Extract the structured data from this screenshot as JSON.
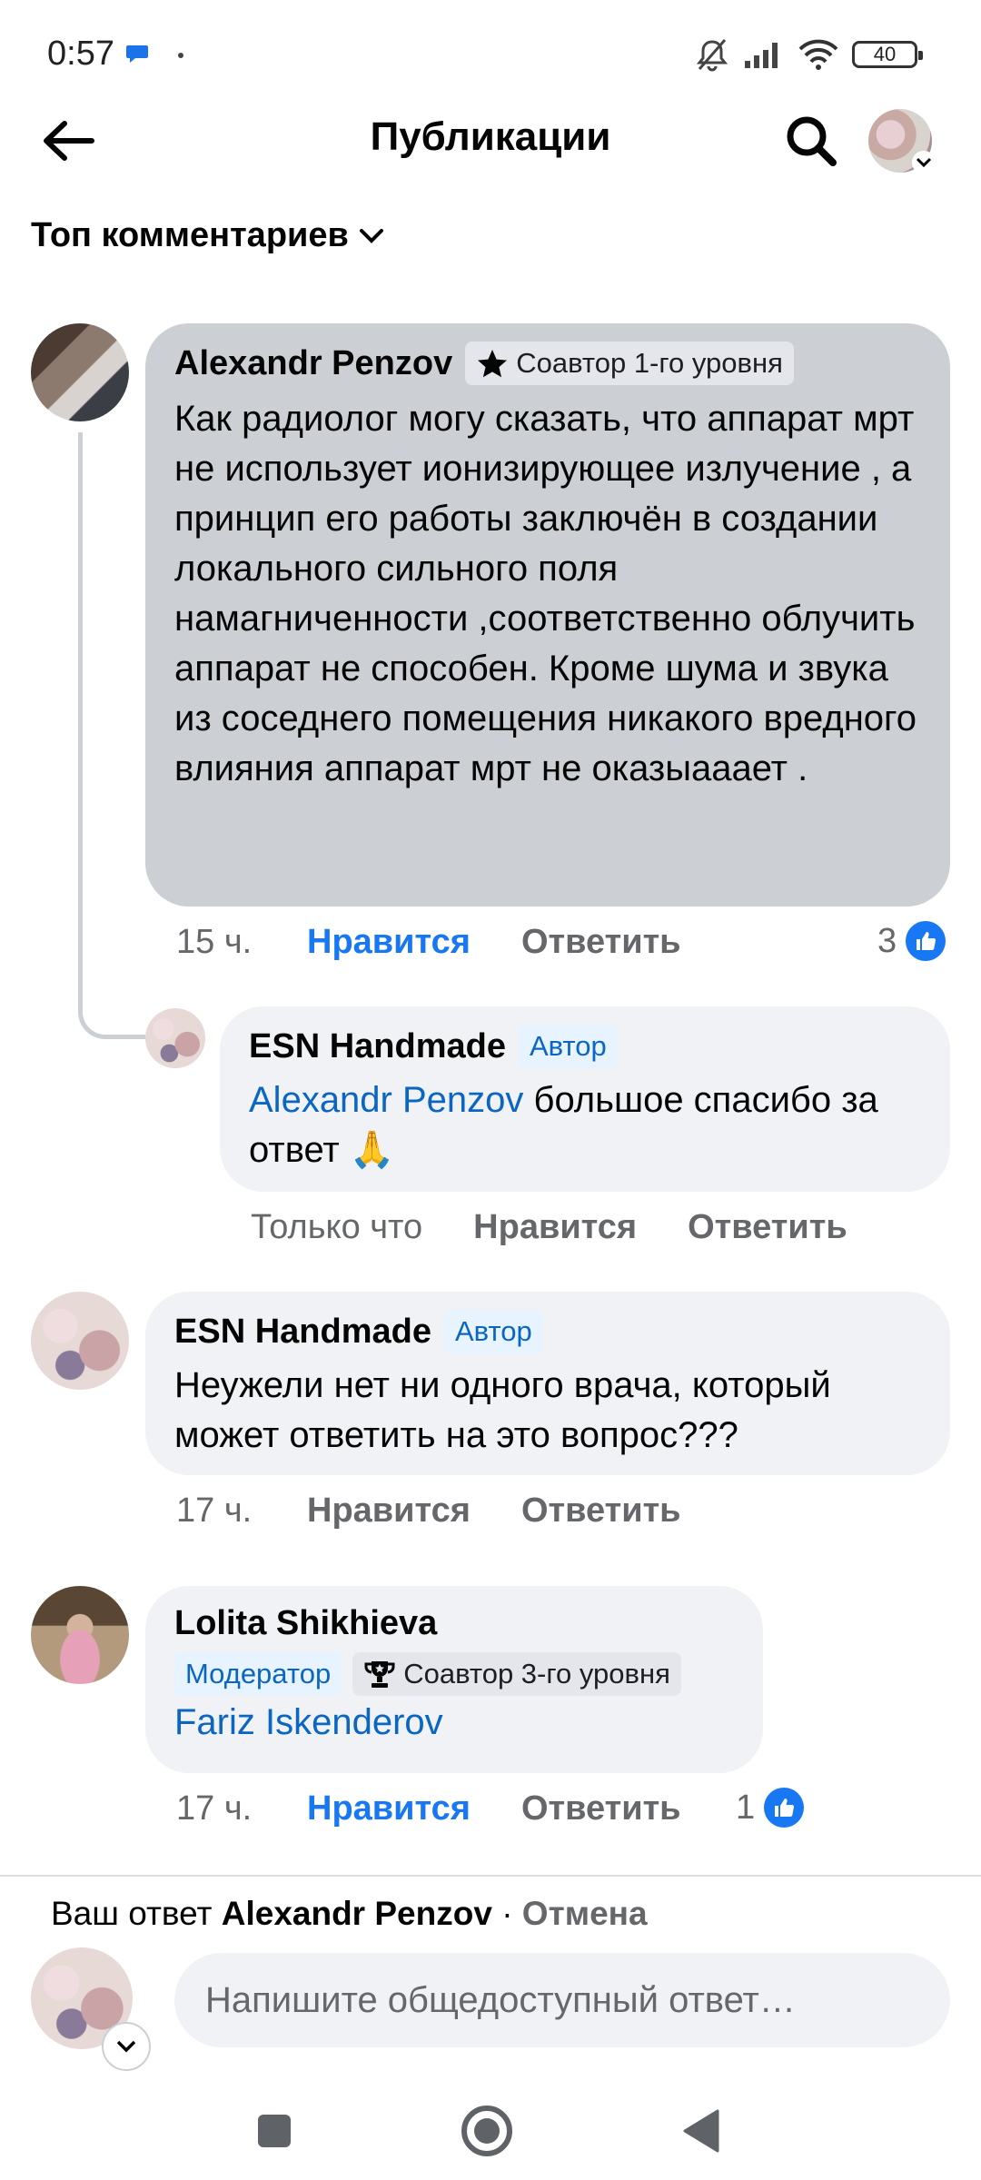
{
  "status_bar": {
    "time": "0:57",
    "battery": "40",
    "icons": [
      "chat-bubble-icon",
      "dot-icon",
      "bell-off-icon",
      "signal-icon",
      "wifi-icon",
      "battery-icon"
    ]
  },
  "header": {
    "title": "Публикации",
    "icons": [
      "back-arrow-icon",
      "search-icon",
      "avatar-chevron-icon"
    ]
  },
  "sort": {
    "label": "Топ комментариев"
  },
  "comments": [
    {
      "author": "Alexandr Penzov",
      "badges": [
        {
          "text": "Соавтор 1-го уровня",
          "icon": "star-icon"
        }
      ],
      "text": "Как радиолог могу сказать, что аппарат мрт не использует ионизирующее излучение , а принцип его работы заключён в создании локального сильного поля намагниченности ,соответственно облучить аппарат не способен. Кроме шума и звука из соседнего помещения никакого вредного влияния аппарат мрт не оказыааает .",
      "time": "15 ч.",
      "like_label": "Нравится",
      "reply_label": "Ответить",
      "like_count": "3",
      "liked": true,
      "replies": [
        {
          "author": "ESN Handmade",
          "badges": [
            {
              "text": "Автор"
            }
          ],
          "mention": "Alexandr Penzov",
          "text": "большое спасибо за ответ 🙏",
          "time": "Только что",
          "like_label": "Нравится",
          "reply_label": "Ответить"
        }
      ]
    },
    {
      "author": "ESN Handmade",
      "badges": [
        {
          "text": "Автор"
        }
      ],
      "text": "Неужели нет ни одного врача, который может ответить на это вопрос???",
      "time": "17 ч.",
      "like_label": "Нравится",
      "reply_label": "Ответить",
      "liked": false
    },
    {
      "author": "Lolita Shikhieva",
      "badges": [
        {
          "text": "Модератор"
        },
        {
          "text": "Соавтор 3-го уровня",
          "icon": "trophy-icon"
        }
      ],
      "mention": "Fariz Iskenderov",
      "time": "17 ч.",
      "like_label": "Нравится",
      "reply_label": "Ответить",
      "like_count": "1",
      "liked": true
    }
  ],
  "composer": {
    "replying_prefix": "Ваш ответ",
    "replying_to": "Alexandr Penzov",
    "separator": "·",
    "cancel": "Отмена",
    "placeholder": "Напишите общедоступный ответ…"
  },
  "colors": {
    "accent": "#1877f2",
    "mention": "#0a66c2",
    "bubble_highlight": "#ccd0d5",
    "bubble": "#f0f2f5",
    "muted_text": "#65676b"
  }
}
